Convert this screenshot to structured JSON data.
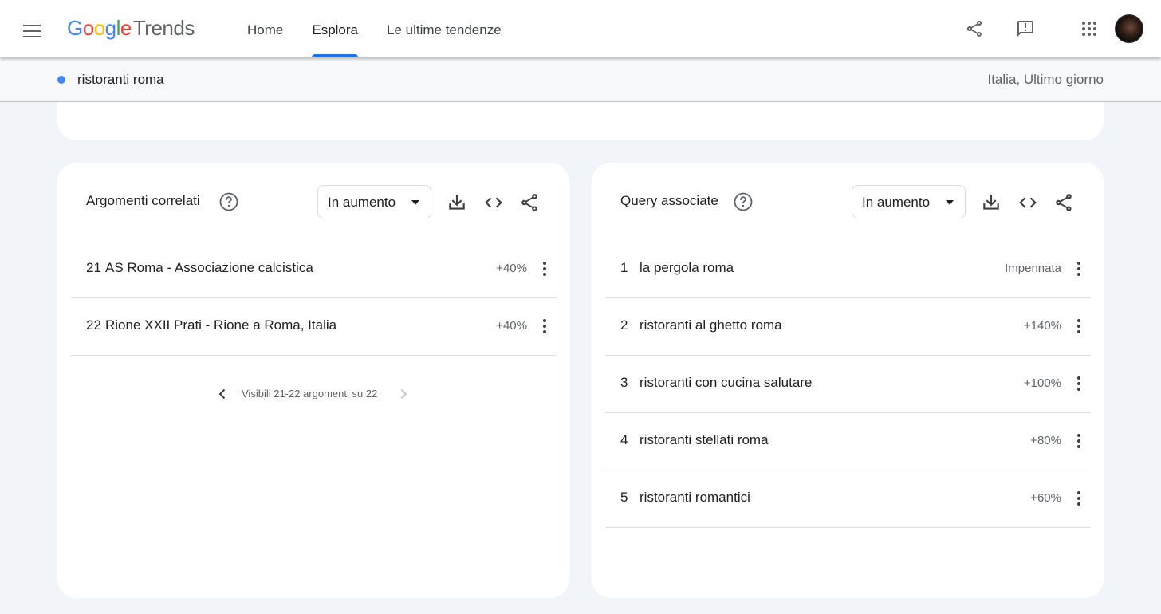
{
  "header": {
    "logo": {
      "g1": "G",
      "o1": "o",
      "o2": "o",
      "g2": "g",
      "l": "l",
      "e": "e",
      "product": "Trends"
    },
    "nav": [
      {
        "label": "Home",
        "active": false
      },
      {
        "label": "Esplora",
        "active": true
      },
      {
        "label": "Le ultime tendenze",
        "active": false
      }
    ],
    "icons": [
      "menu-icon",
      "share-icon",
      "feedback-icon",
      "apps-icon",
      "avatar"
    ]
  },
  "query_bar": {
    "term": "ristoranti roma",
    "term_color": "#4285f4",
    "meta": "Italia, Ultimo giorno"
  },
  "related_topics": {
    "title": "Argomenti correlati",
    "filter": "In aumento",
    "rows": [
      {
        "rank": "21",
        "text": "AS Roma - Associazione calcistica",
        "value": "+40%"
      },
      {
        "rank": "22",
        "text": "Rione XXII Prati - Rione a Roma, Italia",
        "value": "+40%"
      }
    ],
    "pagination": "Visibili 21-22 argomenti su 22"
  },
  "related_queries": {
    "title": "Query associate",
    "filter": "In aumento",
    "rows": [
      {
        "rank": "1",
        "text": "la pergola roma",
        "value": "Impennata"
      },
      {
        "rank": "2",
        "text": "ristoranti al ghetto roma",
        "value": "+140%"
      },
      {
        "rank": "3",
        "text": "ristoranti con cucina salutare",
        "value": "+100%"
      },
      {
        "rank": "4",
        "text": "ristoranti stellati roma",
        "value": "+80%"
      },
      {
        "rank": "5",
        "text": "ristoranti romantici",
        "value": "+60%"
      }
    ]
  },
  "colors": {
    "accent": "#1a73e8",
    "background": "#f1f4f9",
    "card": "#ffffff",
    "divider": "#dadce0"
  }
}
